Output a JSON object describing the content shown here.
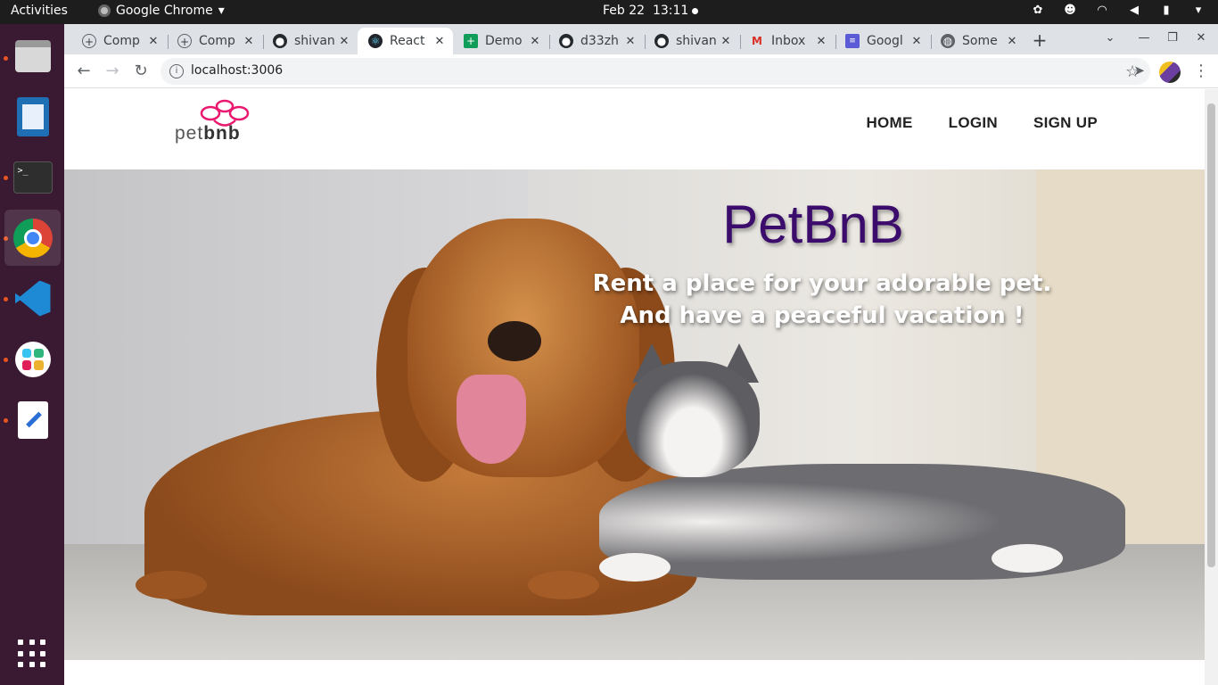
{
  "system": {
    "activities": "Activities",
    "app_name": "Google Chrome",
    "date": "Feb 22",
    "time": "13:11"
  },
  "dock": {
    "items": [
      "files-icon",
      "writer-icon",
      "terminal-icon",
      "chrome-icon",
      "vscode-icon",
      "slack-icon",
      "text-editor-icon"
    ]
  },
  "tabs": [
    {
      "title": "Comp",
      "icon": "globe-icon"
    },
    {
      "title": "Comp",
      "icon": "globe-icon"
    },
    {
      "title": "shivan",
      "icon": "github-icon"
    },
    {
      "title": "React",
      "icon": "react-icon",
      "active": true
    },
    {
      "title": "Demo",
      "icon": "sheets-icon"
    },
    {
      "title": "d33zh",
      "icon": "github-icon"
    },
    {
      "title": "shivan",
      "icon": "github-icon"
    },
    {
      "title": "Inbox",
      "icon": "gmail-icon"
    },
    {
      "title": "Googl",
      "icon": "google-forms-icon"
    },
    {
      "title": "Some",
      "icon": "globe-icon"
    }
  ],
  "toolbar": {
    "url": "localhost:3006"
  },
  "site": {
    "logo_text_light": "pet",
    "logo_text_bold": "bnb",
    "nav": {
      "home": "HOME",
      "login": "LOGIN",
      "signup": "SIGN UP"
    },
    "hero": {
      "title": "PetBnB",
      "subtitle_line1": "Rent a place for your adorable pet.",
      "subtitle_line2": "And have a peaceful vacation !"
    }
  },
  "colors": {
    "brand_pink": "#e8196e",
    "hero_title": "#3b0c6b",
    "dock_bg": "#3a1a32",
    "accent_orange": "#e95420"
  }
}
